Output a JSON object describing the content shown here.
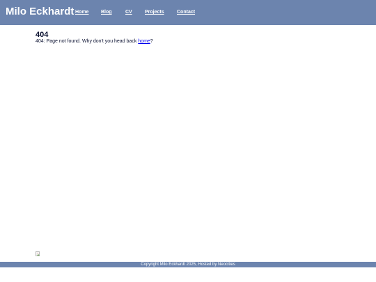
{
  "header": {
    "site_title": "Milo Eckhardt",
    "nav": [
      {
        "label": "Home"
      },
      {
        "label": "Blog"
      },
      {
        "label": "CV"
      },
      {
        "label": "Projects"
      },
      {
        "label": "Contact"
      }
    ],
    "background_color": "#6c84ae"
  },
  "main": {
    "heading": "404",
    "message_prefix": "404: Page not found. Why don't you head back ",
    "message_link": "home",
    "message_suffix": "?"
  },
  "footer": {
    "text": "Copyright Milo Eckhardt 2025, Hosted by Neocities"
  },
  "colors": {
    "accent": "#6c84ae",
    "link": "#0000ee",
    "text": "#0a1030"
  }
}
